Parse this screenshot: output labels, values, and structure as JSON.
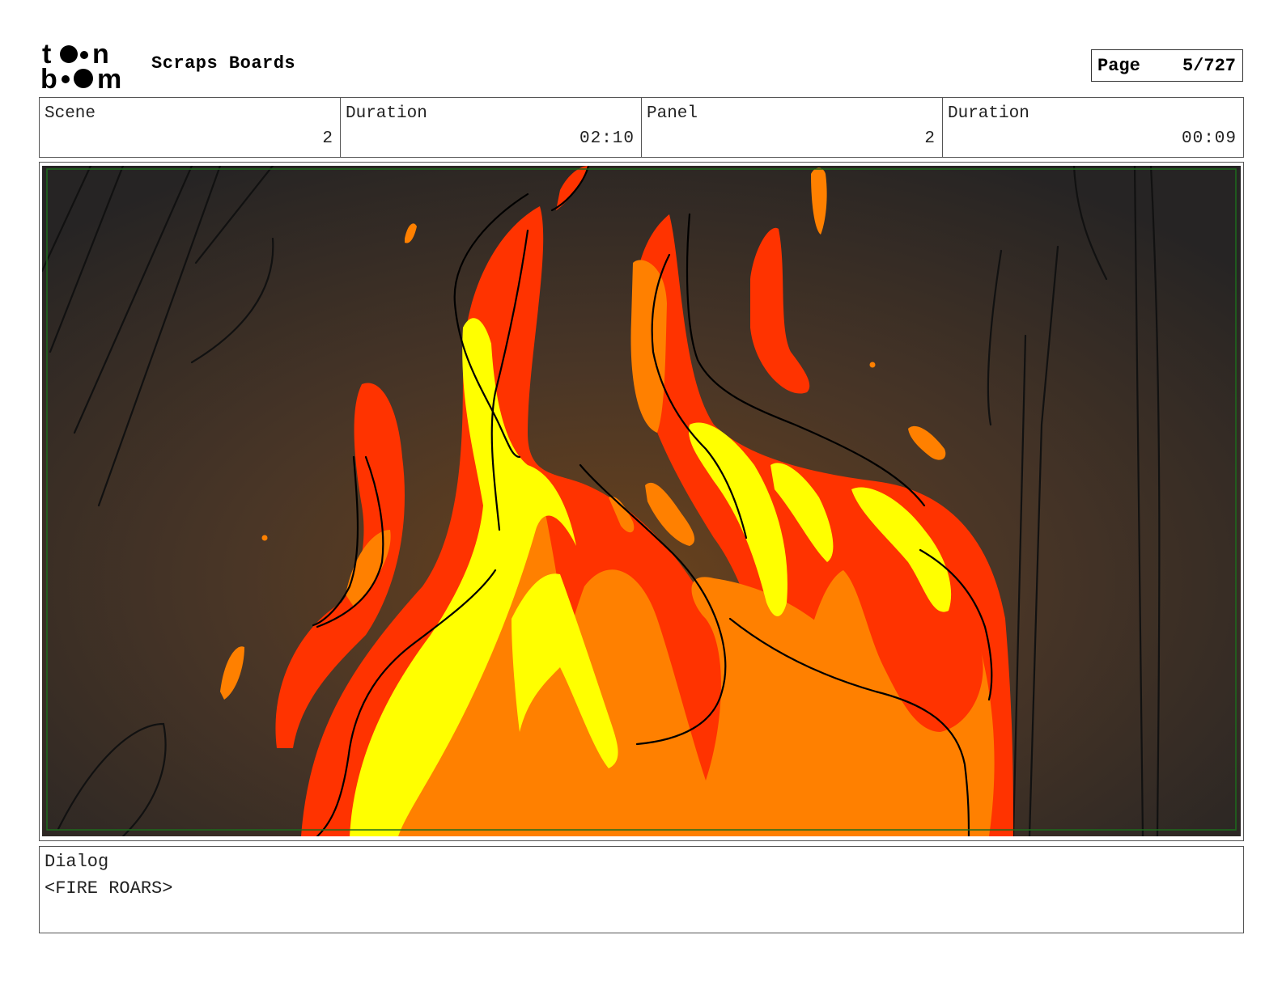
{
  "header": {
    "logo_text": "toonboom",
    "project_title": "Scraps Boards",
    "page_label": "Page",
    "page_value": "5/727"
  },
  "info": {
    "scene_label": "Scene",
    "scene_value": "2",
    "scene_duration_label": "Duration",
    "scene_duration_value": "02:10",
    "panel_label": "Panel",
    "panel_value": "2",
    "panel_duration_label": "Duration",
    "panel_duration_value": "00:09"
  },
  "panel_image": {
    "subject": "fire",
    "colors": {
      "background_dark": "#2b2623",
      "background_glow": "#5a3a1c",
      "flame_red": "#ff3300",
      "flame_orange": "#ff8000",
      "flame_yellow": "#ffff00",
      "safe_frame": "#1d6b1d"
    }
  },
  "dialog": {
    "label": "Dialog",
    "text": "<FIRE ROARS>"
  }
}
